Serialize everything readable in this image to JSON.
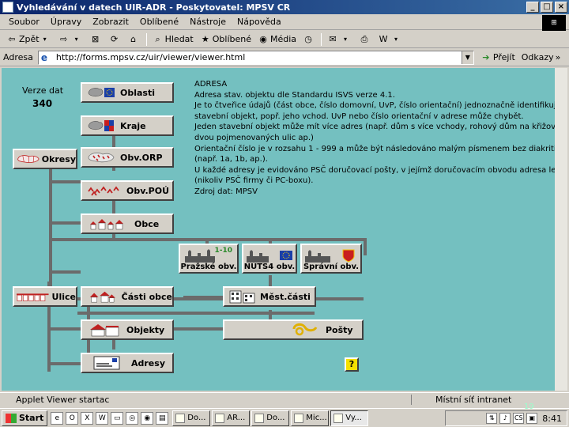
{
  "window": {
    "title": "Vyhledávání v datech UIR-ADR - Poskytovatel: MPSV CR",
    "controls": [
      "_",
      "□",
      "×"
    ]
  },
  "menu": [
    "Soubor",
    "Úpravy",
    "Zobrazit",
    "Oblíbené",
    "Nástroje",
    "Nápověda"
  ],
  "toolbar": {
    "back": "Zpět",
    "search": "Hledat",
    "favorites": "Oblíbené",
    "media": "Média"
  },
  "address": {
    "label": "Adresa",
    "url": "http://forms.mpsv.cz/uir/viewer/viewer.html",
    "go": "Přejít",
    "links": "Odkazy"
  },
  "content": {
    "version_label": "Verze dat",
    "version_value": "340",
    "buttons": {
      "oblasti": "Oblasti",
      "kraje": "Kraje",
      "okresy": "Okresy",
      "obv_orp": "Obv.ORP",
      "obv_pou": "Obv.POÚ",
      "obce": "Obce",
      "prazske_obv": "Pražské obv.",
      "nuts4_obv": "NUTS4 obv.",
      "spravni_obv": "Správní obv.",
      "ulice": "Ulice",
      "casti_obce": "Části obce",
      "mest_casti": "Měst.části",
      "objekty": "Objekty",
      "posty": "Pošty",
      "adresy": "Adresy"
    },
    "prague_badge": "1-10",
    "info_lines": [
      "ADRESA",
      "Adresa stav. objektu dle Standardu ISVS verze 4.1.",
      "Je to čtveřice údajů (část obce, číslo domovní, UvP, číslo orientační) jednoznačně identifikujíc",
      "stavební objekt, popř. jeho vchod. UvP nebo číslo orientační v adrese může chybět.",
      "Jeden stavební objekt může mít více adres (např. dům s více vchody, rohový dům na křižovatce",
      "dvou pojmenovaných ulic ap.)",
      "Orientační číslo je v rozsahu 1 - 999 a může být následováno malým písmenem bez diakritiky",
      "(např. 1a, 1b, ap.).",
      "U každé adresy je evidováno PSČ doručovací pošty, v jejímž doručovacím obvodu adresa leží",
      "(nikoliv PSČ firmy či PC-boxu).",
      "Zdroj dat: MPSV"
    ],
    "help": "?"
  },
  "status": {
    "left": "Applet Viewer startac",
    "zone": "Místní síť intranet"
  },
  "taskbar": {
    "start": "Start",
    "tasks": [
      "Do...",
      "AR...",
      "Do...",
      "Mic...",
      "Vy..."
    ],
    "clock": "8:41",
    "slide_number": "19"
  },
  "colors": {
    "content_bg": "#74c0c0",
    "title_start": "#0a246a",
    "title_end": "#3a6ea5"
  }
}
